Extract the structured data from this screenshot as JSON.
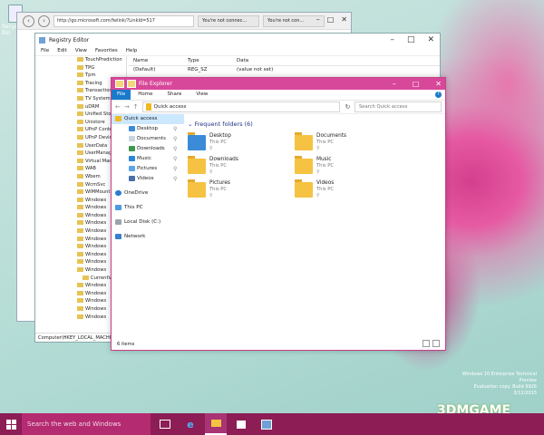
{
  "desktop": {
    "recycle_label": "Recycle Bin"
  },
  "browser": {
    "url": "http://go.microsoft.com/fwlink/?LinkId=517",
    "tab1": "You're not connec...",
    "tab2": "You're not con..."
  },
  "regedit": {
    "title": "Registry Editor",
    "menu": [
      "File",
      "Edit",
      "View",
      "Favorites",
      "Help"
    ],
    "tree": [
      "TouchPrediction",
      "TPG",
      "Tpm",
      "Tracing",
      "Transaction",
      "TV System",
      "uDRM",
      "Unified Store",
      "Unistore",
      "UPnP Control",
      "UPnP Device",
      "UserData",
      "UserManager",
      "Virtual Machine",
      "WAB",
      "Wbem",
      "WcmSvc",
      "WIMMount",
      "Windows",
      "Windows",
      "Windows",
      "Windows",
      "Windows",
      "Windows",
      "Windows",
      "Windows",
      "Windows",
      "Windows"
    ],
    "tree_child": "CurrentVersion",
    "tree_after": [
      "Windows",
      "Windows",
      "Windows",
      "Windows",
      "Windows"
    ],
    "headers": [
      "Name",
      "Type",
      "Data"
    ],
    "row": {
      "name": "(Default)",
      "type": "REG_SZ",
      "data": "(value not set)"
    },
    "status": "Computer\\HKEY_LOCAL_MACHINE"
  },
  "explorer": {
    "title": "File Explorer",
    "ribbon": [
      "File",
      "Home",
      "Share",
      "View"
    ],
    "path": "Quick access",
    "search_placeholder": "Search Quick access",
    "nav": {
      "quick_access": "Quick access",
      "items": [
        "Desktop",
        "Documents",
        "Downloads",
        "Music",
        "Pictures",
        "Videos"
      ],
      "onedrive": "OneDrive",
      "thispc": "This PC",
      "localdisk": "Local Disk (C:)",
      "network": "Network"
    },
    "group": "Frequent folders (6)",
    "tiles": [
      {
        "name": "Desktop",
        "sub": "This PC"
      },
      {
        "name": "Documents",
        "sub": "This PC"
      },
      {
        "name": "Downloads",
        "sub": "This PC"
      },
      {
        "name": "Music",
        "sub": "This PC"
      },
      {
        "name": "Pictures",
        "sub": "This PC"
      },
      {
        "name": "Videos",
        "sub": "This PC"
      }
    ],
    "status": "6 items"
  },
  "watermark": {
    "line1": "Windows 10 Enterprise Technical Preview",
    "line2": "Evaluation copy. Build 9926",
    "line3": "3/12/2015"
  },
  "logo": "3DMGAME",
  "taskbar": {
    "search_placeholder": "Search the web and Windows"
  },
  "colors": {
    "accent": "#d8489a",
    "taskbar": "#8c1d55",
    "file_tab": "#1979ca"
  }
}
